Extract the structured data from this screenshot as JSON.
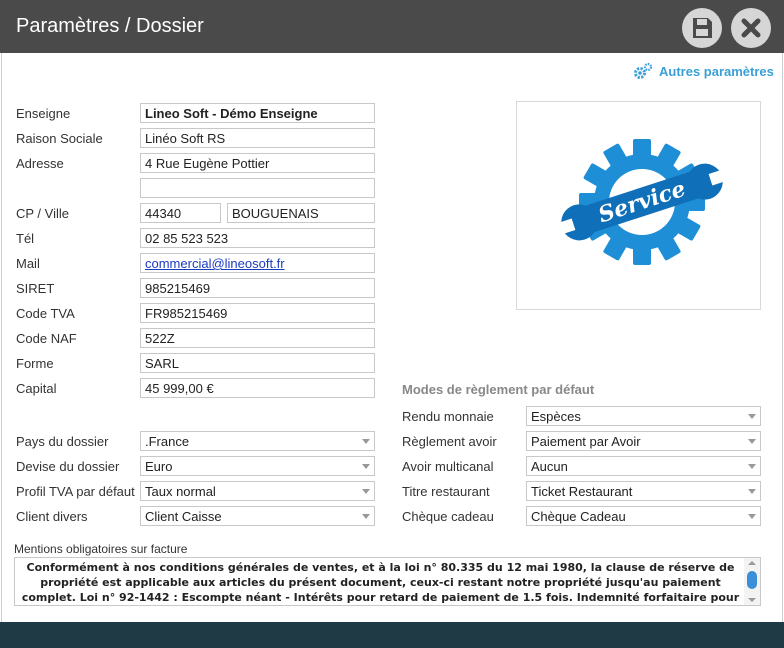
{
  "window": {
    "title": "Paramètres / Dossier"
  },
  "toolbar": {
    "autres_label": "Autres paramètres"
  },
  "form": {
    "enseigne": {
      "label": "Enseigne",
      "value": "Lineo Soft - Démo Enseigne"
    },
    "raison_sociale": {
      "label": "Raison Sociale",
      "value": "Linéo Soft RS"
    },
    "adresse": {
      "label": "Adresse",
      "value": "4 Rue Eugène Pottier",
      "value2": ""
    },
    "cp_ville": {
      "label": "CP / Ville",
      "cp": "44340",
      "ville": "BOUGUENAIS"
    },
    "tel": {
      "label": "Tél",
      "value": "02 85 523 523"
    },
    "mail": {
      "label": "Mail",
      "value": "commercial@lineosoft.fr"
    },
    "siret": {
      "label": "SIRET",
      "value": "985215469"
    },
    "code_tva": {
      "label": "Code TVA",
      "value": "FR985215469"
    },
    "code_naf": {
      "label": "Code NAF",
      "value": "522Z"
    },
    "forme": {
      "label": "Forme",
      "value": "SARL"
    },
    "capital": {
      "label": "Capital",
      "value": "45 999,00 €"
    }
  },
  "left_selects": [
    {
      "label": "Pays du dossier",
      "value": ".France"
    },
    {
      "label": "Devise du dossier",
      "value": "Euro"
    },
    {
      "label": "Profil TVA par défaut",
      "value": "Taux normal"
    },
    {
      "label": "Client divers",
      "value": "Client Caisse"
    }
  ],
  "modes": {
    "title": "Modes de règlement par défaut",
    "items": [
      {
        "label": "Rendu monnaie",
        "value": "Espèces"
      },
      {
        "label": "Règlement avoir",
        "value": "Paiement par Avoir"
      },
      {
        "label": "Avoir multicanal",
        "value": "Aucun"
      },
      {
        "label": "Titre restaurant",
        "value": "Ticket Restaurant"
      },
      {
        "label": "Chèque cadeau",
        "value": "Chèque Cadeau"
      }
    ]
  },
  "logo": {
    "text": "Service"
  },
  "mentions": {
    "label": "Mentions obligatoires sur facture",
    "text": "Conformément à nos conditions générales de ventes, et à la loi n° 80.335 du 12 mai 1980, la clause de réserve de propriété est applicable aux articles du présent document, ceux-ci restant notre propriété jusqu'au paiement complet. Loi n° 92-1442 : Escompte néant - Intérêts pour retard de paiement de 1.5 fois. Indemnité forfaitaire pour frais de"
  },
  "colors": {
    "titlebar": "#4a4a4a",
    "accent": "#3a9fd8",
    "footer": "#1f3a45",
    "logo_blue": "#1e8fd6"
  }
}
